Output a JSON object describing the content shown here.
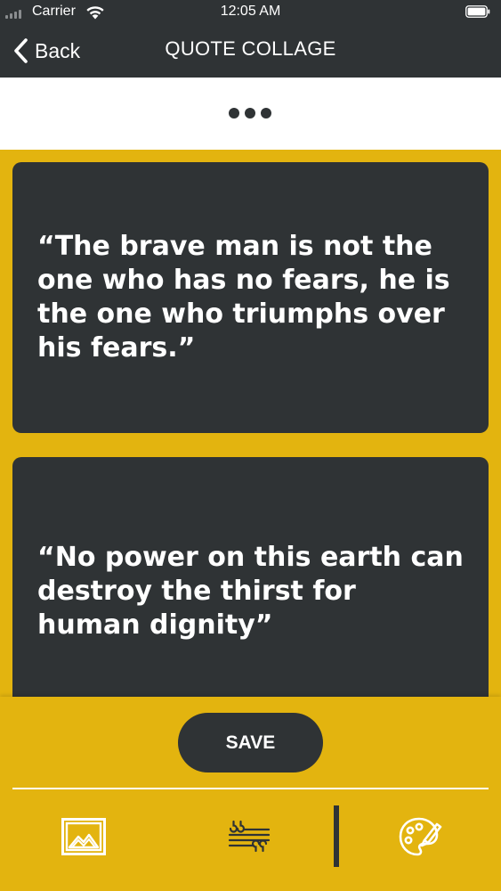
{
  "status_bar": {
    "carrier": "Carrier",
    "time": "12:05 AM",
    "icons": [
      "signal-icon",
      "wifi-icon",
      "battery-icon"
    ]
  },
  "nav": {
    "back_label": "Back",
    "back_icon": "chevron-left-icon",
    "title": "QUOTE COLLAGE"
  },
  "toolbar": {
    "more_icon": "more-dots-icon"
  },
  "quotes": [
    {
      "text": "“The brave man is not the one who has no fears, he is the one who triumphs over his fears.”"
    },
    {
      "text": "“No power on this earth can destroy the thirst for human dignity”"
    }
  ],
  "actions": {
    "save_label": "SAVE"
  },
  "bottom_toolbar": {
    "icons": [
      "image-icon",
      "quote-text-icon",
      "palette-icon"
    ]
  },
  "colors": {
    "background": "#E3B40F",
    "dark": "#2F3335",
    "white": "#FFFFFF"
  }
}
